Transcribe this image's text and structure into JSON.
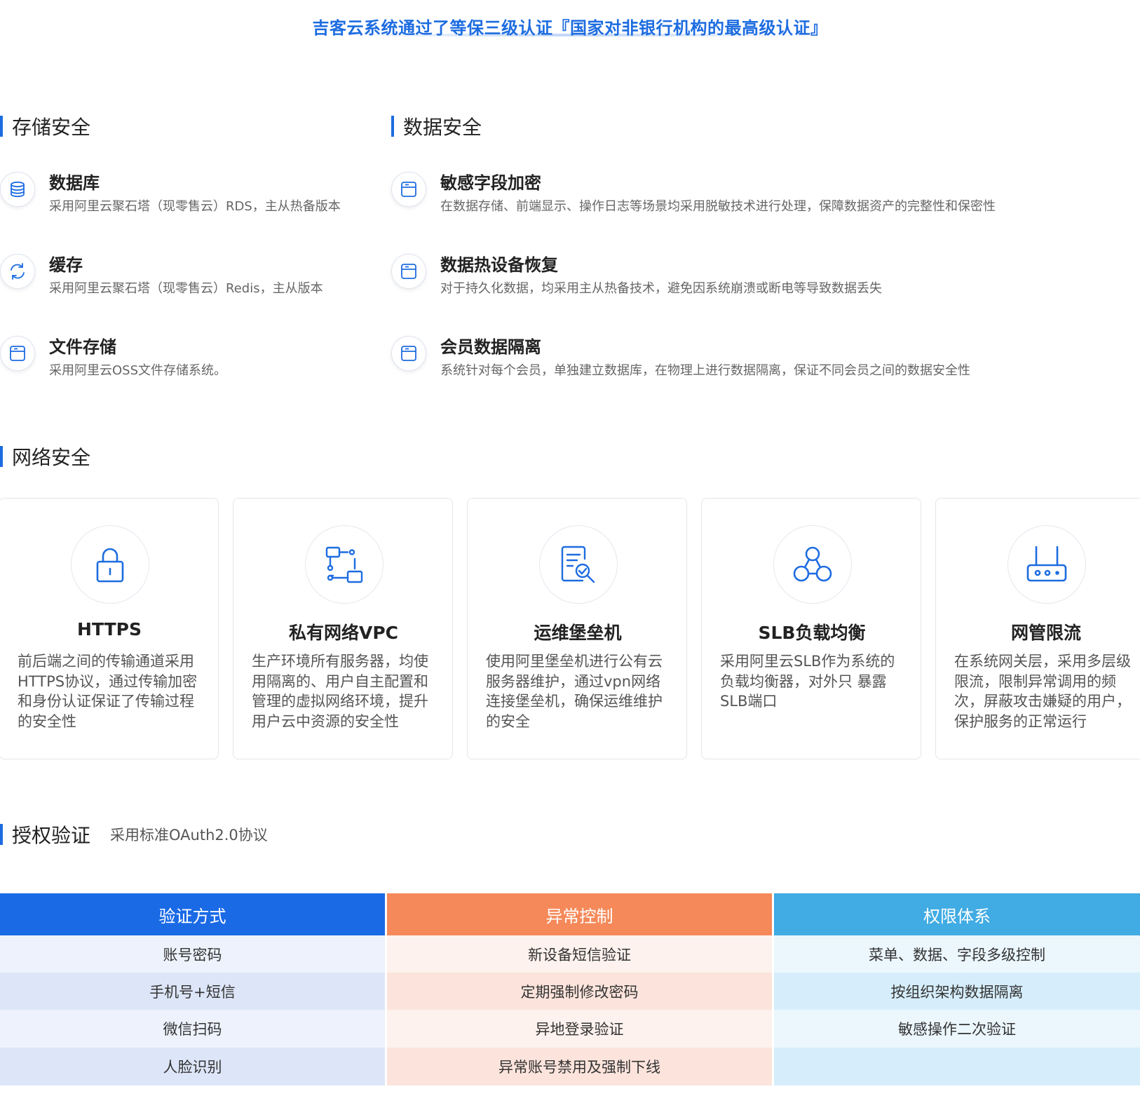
{
  "banner": {
    "title": "吉客云系统通过了等保三级认证『国家对非银行机构的最高级认证』"
  },
  "storage": {
    "title": "存储安全",
    "items": [
      {
        "icon": "database-icon",
        "name": "数据库",
        "desc": "采用阿里云聚石塔（现零售云）RDS，主从热备版本"
      },
      {
        "icon": "sync-icon",
        "name": "缓存",
        "desc": "采用阿里云聚石塔（现零售云）Redis，主从版本"
      },
      {
        "icon": "storage-box-icon",
        "name": "文件存储",
        "desc": "采用阿里云OSS文件存储系统。"
      }
    ]
  },
  "data_security": {
    "title": "数据安全",
    "items": [
      {
        "icon": "storage-box-icon",
        "name": "敏感字段加密",
        "desc": "在数据存储、前端显示、操作日志等场景均采用脱敏技术进行处理，保障数据资产的完整性和保密性"
      },
      {
        "icon": "storage-box-icon",
        "name": "数据热设备恢复",
        "desc": "对于持久化数据，均采用主从热备技术，避免因系统崩溃或断电等导致数据丢失"
      },
      {
        "icon": "storage-box-icon",
        "name": "会员数据隔离",
        "desc": "系统针对每个会员，单独建立数据库，在物理上进行数据隔离，保证不同会员之间的数据安全性"
      }
    ]
  },
  "network": {
    "title": "网络安全",
    "cards": [
      {
        "icon": "lock-icon",
        "title": "HTTPS",
        "desc": "前后端之间的传输通道采用HTTPS协议，通过传输加密和身份认证保证了传输过程的安全性"
      },
      {
        "icon": "network-topology-icon",
        "title": "私有网络VPC",
        "desc": "生产环境所有服务器，均使用隔离的、用户自主配置和管理的虚拟网络环境，提升用户云中资源的安全性"
      },
      {
        "icon": "document-search-icon",
        "title": "运维堡垒机",
        "desc": "使用阿里堡垒机进行公有云服务器维护，通过vpn网络连接堡垒机，确保运维维护的安全"
      },
      {
        "icon": "load-balancer-icon",
        "title": "SLB负载均衡",
        "desc": "采用阿里云SLB作为系统的负载均衡器，对外只 暴露SLB端口"
      },
      {
        "icon": "router-icon",
        "title": "网管限流",
        "desc": "在系统网关层，采用多层级限流，限制异常调用的频次，屏蔽攻击嫌疑的用户，保护服务的正常运行"
      }
    ]
  },
  "auth": {
    "title": "授权验证",
    "subtitle": "采用标准OAuth2.0协议",
    "columns": [
      {
        "header": "验证方式",
        "color": "#1a6ae6",
        "rows": [
          "账号密码",
          "手机号+短信",
          "微信扫码",
          "人脸识别"
        ]
      },
      {
        "header": "异常控制",
        "color": "#f5895a",
        "rows": [
          "新设备短信验证",
          "定期强制修改密码",
          "异地登录验证",
          "异常账号禁用及强制下线"
        ]
      },
      {
        "header": "权限体系",
        "color": "#41abe3",
        "rows": [
          "菜单、数据、字段多级控制",
          "按组织架构数据隔离",
          "敏感操作二次验证",
          ""
        ]
      }
    ]
  }
}
